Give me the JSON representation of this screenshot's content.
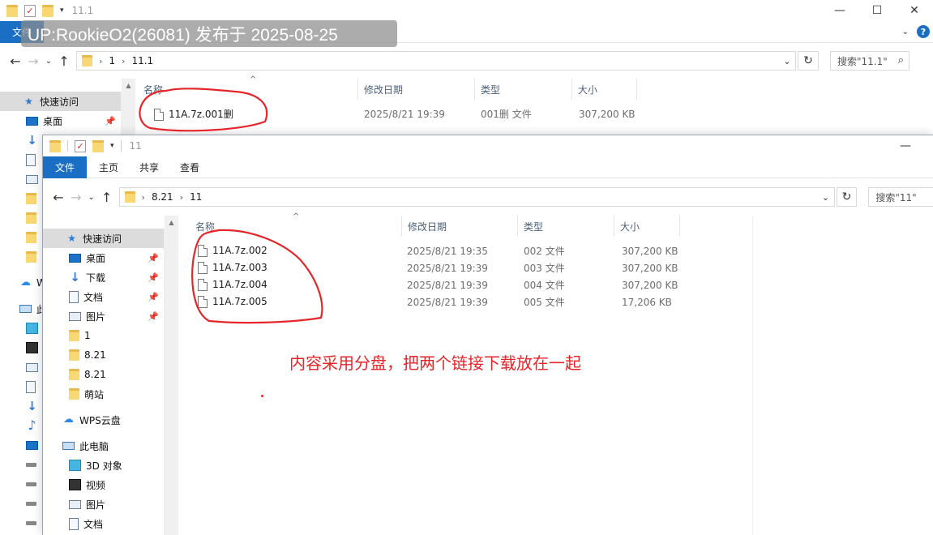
{
  "watermark": "UP:RookieO2(26081) 发布于 2025-08-25",
  "annotation": "内容采用分盘，把两个链接下载放在一起",
  "back_window": {
    "title": "11.1",
    "ribbon_file": "文件",
    "breadcrumb": [
      "1",
      "11.1"
    ],
    "search_placeholder": "搜索\"11.1\"",
    "columns": {
      "name": "名称",
      "modified": "修改日期",
      "type": "类型",
      "size": "大小"
    },
    "nav": {
      "quick_access": "快速访问",
      "desktop": "桌面",
      "wps_partial": "W",
      "pc_partial": "此"
    },
    "files": [
      {
        "name": "11A.7z.001删",
        "modified": "2025/8/21 19:39",
        "type": "001删 文件",
        "size": "307,200 KB"
      }
    ]
  },
  "front_window": {
    "title": "11",
    "tabs": [
      "文件",
      "主页",
      "共享",
      "查看"
    ],
    "breadcrumb": [
      "8.21",
      "11"
    ],
    "search_placeholder": "搜索\"11\"",
    "columns": {
      "name": "名称",
      "modified": "修改日期",
      "type": "类型",
      "size": "大小"
    },
    "nav": [
      {
        "label": "快速访问",
        "icon": "star-icon",
        "pinned": false,
        "selected": true,
        "indent": 0
      },
      {
        "label": "桌面",
        "icon": "desktop-icon",
        "pinned": true,
        "indent": 1
      },
      {
        "label": "下载",
        "icon": "download-icon",
        "pinned": true,
        "indent": 1
      },
      {
        "label": "文档",
        "icon": "document-icon",
        "pinned": true,
        "indent": 1
      },
      {
        "label": "图片",
        "icon": "picture-icon",
        "pinned": true,
        "indent": 1
      },
      {
        "label": "1",
        "icon": "folder-icon",
        "pinned": false,
        "indent": 1
      },
      {
        "label": "8.21",
        "icon": "folder-icon",
        "pinned": false,
        "indent": 1
      },
      {
        "label": "8.21",
        "icon": "folder-icon",
        "pinned": false,
        "indent": 1
      },
      {
        "label": "萌站",
        "icon": "folder-icon",
        "pinned": false,
        "indent": 1
      },
      {
        "label": "WPS云盘",
        "icon": "cloud-icon",
        "pinned": false,
        "indent": 0,
        "gap": true
      },
      {
        "label": "此电脑",
        "icon": "computer-icon",
        "pinned": false,
        "indent": 0,
        "gap": true
      },
      {
        "label": "3D 对象",
        "icon": "3d-objects-icon",
        "pinned": false,
        "indent": 1
      },
      {
        "label": "视频",
        "icon": "video-icon",
        "pinned": false,
        "indent": 1
      },
      {
        "label": "图片",
        "icon": "picture-icon",
        "pinned": false,
        "indent": 1
      },
      {
        "label": "文档",
        "icon": "document-icon",
        "pinned": false,
        "indent": 1
      }
    ],
    "files": [
      {
        "name": "11A.7z.002",
        "modified": "2025/8/21 19:35",
        "type": "002 文件",
        "size": "307,200 KB"
      },
      {
        "name": "11A.7z.003",
        "modified": "2025/8/21 19:39",
        "type": "003 文件",
        "size": "307,200 KB"
      },
      {
        "name": "11A.7z.004",
        "modified": "2025/8/21 19:39",
        "type": "004 文件",
        "size": "307,200 KB"
      },
      {
        "name": "11A.7z.005",
        "modified": "2025/8/21 19:39",
        "type": "005 文件",
        "size": "17,206 KB"
      }
    ]
  },
  "colors": {
    "accent": "#1a6fc4",
    "annotation_red": "#e5252a"
  }
}
